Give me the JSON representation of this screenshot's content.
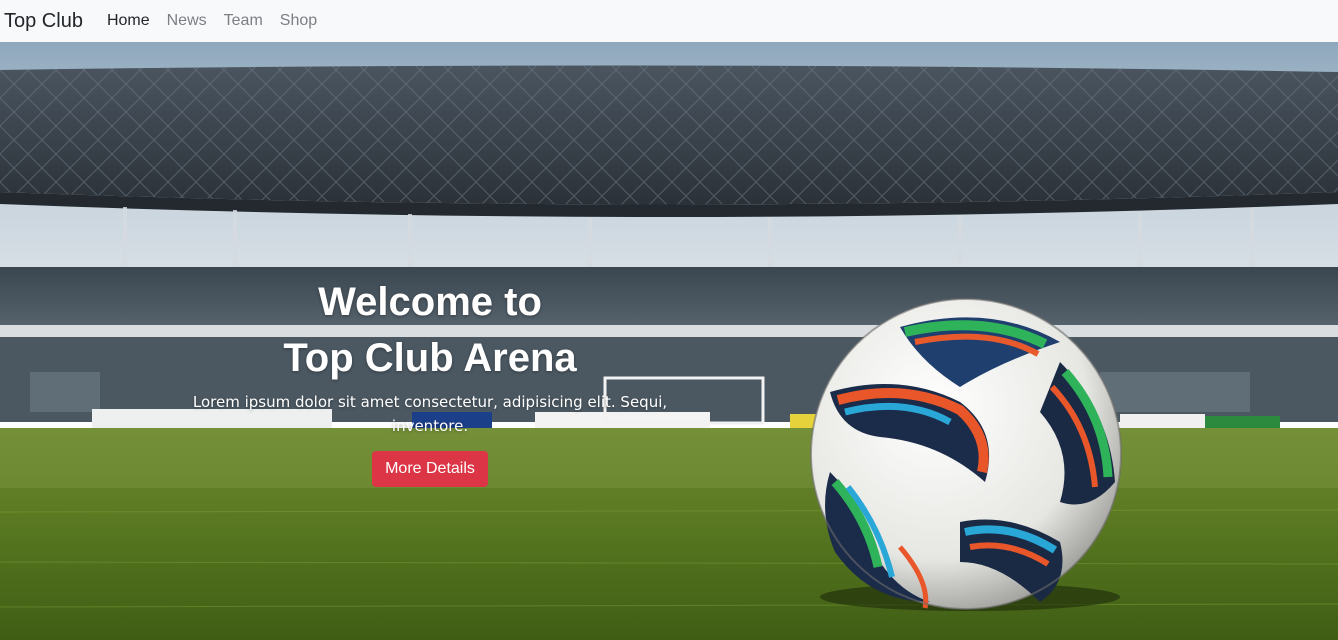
{
  "navbar": {
    "brand": "Top Club",
    "links": [
      {
        "label": "Home",
        "active": true
      },
      {
        "label": "News",
        "active": false
      },
      {
        "label": "Team",
        "active": false
      },
      {
        "label": "Shop",
        "active": false
      }
    ]
  },
  "hero": {
    "title_line1": "Welcome to",
    "title_line2": "Top Club Arena",
    "subtitle": "Lorem ipsum dolor sit amet consectetur, adipisicing elit. Sequi, inventore.",
    "button_label": "More Details",
    "button_color": "#dc3545",
    "background_image": "soccer-ball-in-stadium"
  },
  "colors": {
    "navbar_bg": "#f8f9fa",
    "text_dark": "#212529",
    "text_muted": "#7b7f84"
  }
}
